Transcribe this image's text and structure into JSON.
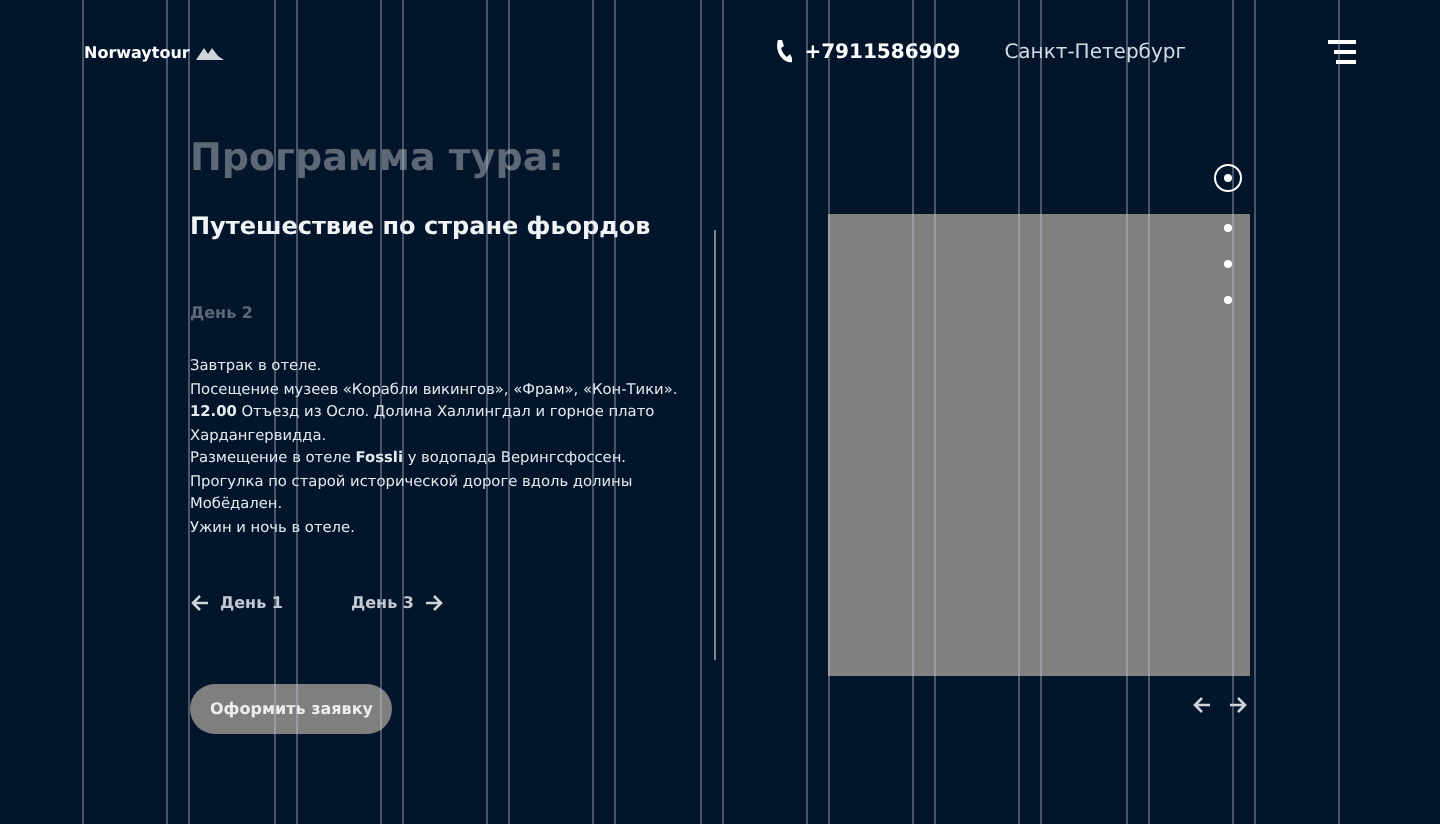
{
  "header": {
    "logo": "Norwaytour",
    "phone": "+7911586909",
    "city": "Санкт-Петербург"
  },
  "tour": {
    "heading": "Программа тура:",
    "title": "Путешествие по стране фьордов",
    "day": "День 2",
    "lines": [
      "Завтрак в отеле.",
      " Посещение музеев «Корабли викингов», «Фрам», «Кон-Тики».",
      "**12.00** Отъезд из Осло. Долина Халлингдал и горное плато Хардангервидда.",
      "Размещение в отеле **Fossli** у водопада Верингсфоссен.",
      "Прогулка по старой исторической дороге вдоль долины Мобёдален.",
      "Ужин и ночь в отеле."
    ],
    "prev": "День 1",
    "next": "День 3",
    "button": "Оформить заявку"
  },
  "slider": {
    "dots": [
      {
        "selected": true
      },
      {
        "selected": false
      },
      {
        "selected": false
      },
      {
        "selected": false
      }
    ]
  }
}
